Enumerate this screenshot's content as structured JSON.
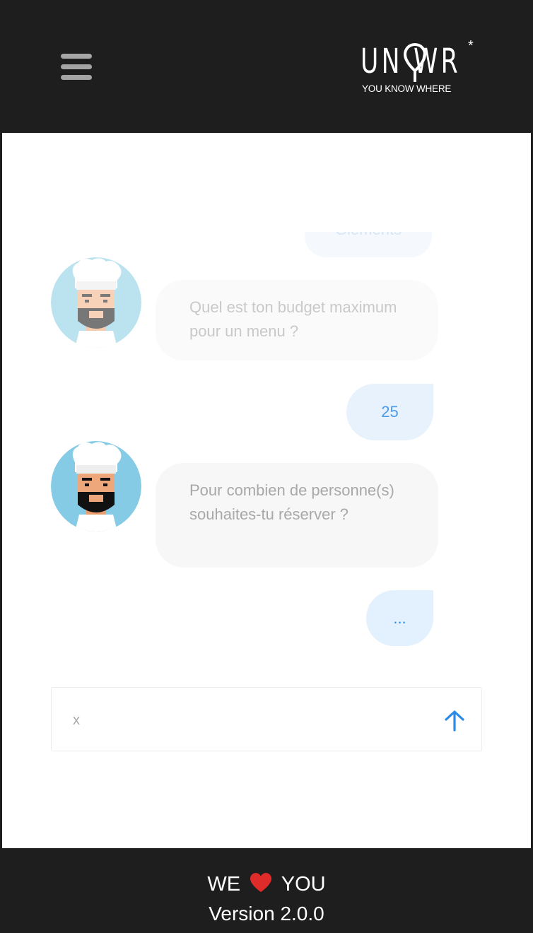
{
  "header": {
    "logo_word": "UN WR",
    "logo_tagline": "YOU KNOW WHERE",
    "logo_mark": "*",
    "menu_icon": "hamburger-menu-icon"
  },
  "chat": {
    "faded_reply": "Gléments",
    "messages": [
      {
        "from": "bot",
        "text": "Quel est ton budget maximum pour un menu ?"
      },
      {
        "from": "user",
        "text": "25"
      },
      {
        "from": "bot",
        "text": "Pour combien de personne(s) souhaites-tu réserver ?"
      },
      {
        "from": "user",
        "text": "..."
      }
    ]
  },
  "composer": {
    "placeholder": "x",
    "send_icon": "arrow-up-icon"
  },
  "footer": {
    "we": "WE",
    "heart_icon": "heart-icon",
    "you": "YOU",
    "version": "Version 2.0.0"
  },
  "colors": {
    "header_bg": "#1e1e1f",
    "accent_blue": "#2b8ae8",
    "user_bubble": "#e3f0fd",
    "bot_bubble": "#f7f7f7",
    "heart": "#e02b2b"
  }
}
